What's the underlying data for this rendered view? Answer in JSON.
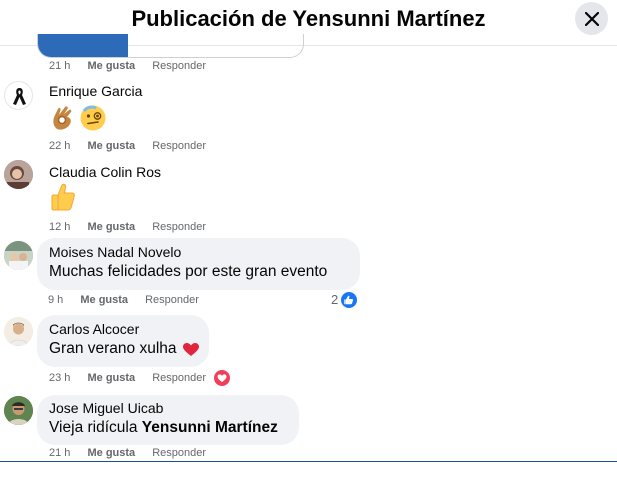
{
  "header": {
    "title": "Publicación de Yensunni Martínez"
  },
  "actions": {
    "like": "Me gusta",
    "reply": "Responder"
  },
  "comments": [
    {
      "time": "21 h"
    },
    {
      "author": "Enrique Garcia",
      "time": "22 h"
    },
    {
      "author": "Claudia Colin Ros",
      "time": "12 h"
    },
    {
      "author": "Moises Nadal Novelo",
      "text": "Muchas felicidades por este gran evento",
      "time": "9 h",
      "reaction_count": "2"
    },
    {
      "author": "Carlos Alcocer",
      "text": "Gran verano xulha",
      "time": "23 h"
    },
    {
      "author": "Jose Miguel Uicab",
      "text": "Vieja ridícula",
      "mention": "Yensunni Martínez",
      "time": "21 h"
    }
  ],
  "colors": {
    "accent": "#1877f2",
    "love": "#f33e58",
    "bubble": "#f0f2f5",
    "meta": "#65676b"
  }
}
